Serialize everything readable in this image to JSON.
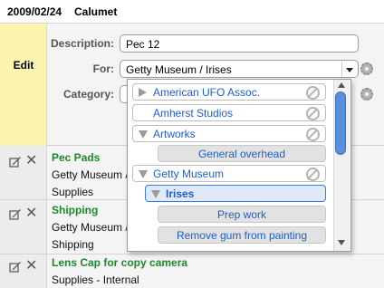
{
  "header": {
    "date": "2009/02/24",
    "name": "Calumet"
  },
  "edit_panel": {
    "edit_label": "Edit",
    "description_label": "Description:",
    "description_value": "Pec 12",
    "for_label": "For:",
    "for_value": "Getty Museum / Irises",
    "category_label": "Category:"
  },
  "dropdown": {
    "options": [
      {
        "label": "American UFO Assoc.",
        "expander": "collapsed"
      },
      {
        "label": "Amherst Studios",
        "expander": "none"
      },
      {
        "label": "Artworks",
        "expander": "expanded"
      },
      {
        "label": "General overhead",
        "expander": "child"
      },
      {
        "label": "Getty Museum",
        "expander": "expanded"
      },
      {
        "label": "Irises",
        "expander": "expanded",
        "selected": true
      },
      {
        "label": "Prep work",
        "expander": "child"
      },
      {
        "label": "Remove gum from painting",
        "expander": "child"
      }
    ]
  },
  "rows": [
    {
      "title": "Pec Pads",
      "line1": "Getty Museum / I",
      "line2": "Supplies"
    },
    {
      "title": "Shipping",
      "line1": "Getty Museum / I",
      "line2": "Shipping"
    },
    {
      "title": "Lens Cap for copy camera",
      "line1": "Supplies - Internal"
    }
  ],
  "icons": [
    "pencil-icon",
    "delete-x-icon",
    "gear-icon",
    "chevron-down-icon",
    "no-entry-icon"
  ],
  "colors": {
    "edit_background": "#fbf5b1",
    "title_green": "#1d8a2a",
    "option_blue": "#1f5fc8",
    "scroll_thumb": "#5a8fdc"
  }
}
